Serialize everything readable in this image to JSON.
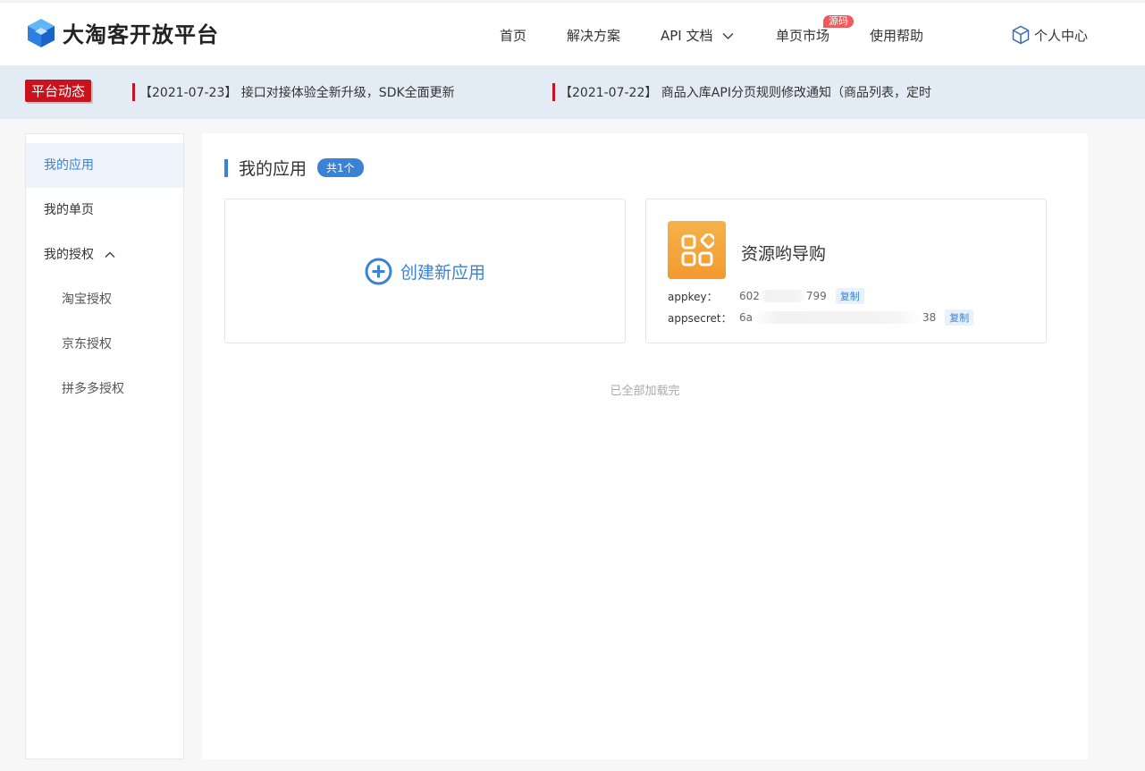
{
  "brand": {
    "name": "大淘客开放平台"
  },
  "nav": {
    "home": "首页",
    "solutions": "解决方案",
    "api_docs": "API 文档",
    "market": "单页市场",
    "market_badge": "源码",
    "help": "使用帮助",
    "user_center": "个人中心"
  },
  "news": {
    "tag": "平台动态",
    "items": [
      "【2021-07-23】 接口对接体验全新升级，SDK全面更新",
      "【2021-07-22】 商品入库API分页规则修改通知（商品列表，定时"
    ]
  },
  "sidebar": {
    "items": [
      {
        "label": "我的应用",
        "active": true
      },
      {
        "label": "我的单页"
      },
      {
        "label": "我的授权",
        "expanded": true
      },
      {
        "label": "淘宝授权",
        "sub": true
      },
      {
        "label": "京东授权",
        "sub": true
      },
      {
        "label": "拼多多授权",
        "sub": true
      }
    ]
  },
  "main": {
    "title": "我的应用",
    "count_badge": "共1个",
    "create_label": "创建新应用",
    "app": {
      "name": "资源哟导购",
      "appkey_label": "appkey：",
      "appkey_prefix": "602",
      "appkey_suffix": "799",
      "appsecret_label": "appsecret：",
      "appsecret_prefix": "6a",
      "appsecret_suffix": "38",
      "copy_label": "复制"
    },
    "footer_text": "已全部加载完"
  },
  "colors": {
    "accent": "#3a82d6",
    "news_red": "#c9121c",
    "newsbar_bg": "#e3ebf4",
    "app_icon_orange": "#f29a2e"
  }
}
